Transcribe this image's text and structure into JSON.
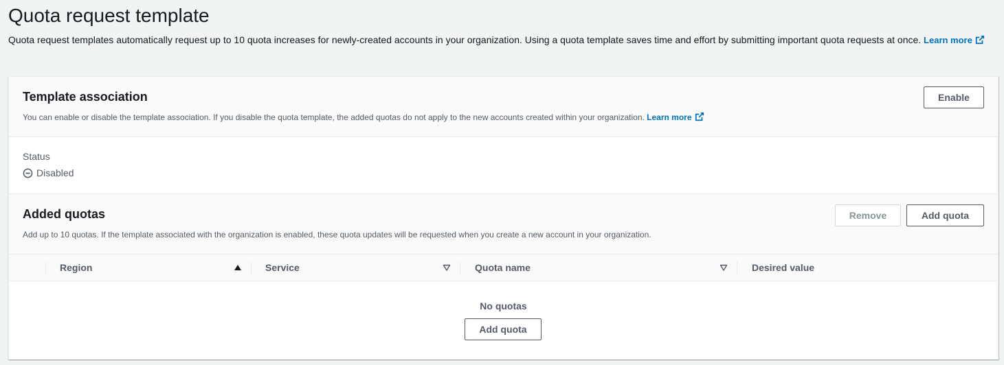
{
  "page": {
    "title": "Quota request template",
    "description": "Quota request templates automatically request up to 10 quota increases for newly-created accounts in your organization. Using a quota template saves time and effort by submitting important quota requests at once.",
    "learn_more": "Learn more"
  },
  "association": {
    "title": "Template association",
    "description": "You can enable or disable the template association. If you disable the quota template, the added quotas do not apply to the new accounts created within your organization.",
    "learn_more": "Learn more",
    "enable_label": "Enable",
    "status_label": "Status",
    "status_value": "Disabled"
  },
  "quotas": {
    "title": "Added quotas",
    "description": "Add up to 10 quotas. If the template associated with the organization is enabled, these quota updates will be requested when you create a new account in your organization.",
    "remove_label": "Remove",
    "add_label": "Add quota",
    "columns": [
      "Region",
      "Service",
      "Quota name",
      "Desired value"
    ],
    "sort": {
      "column": "Region",
      "direction": "ascending"
    },
    "empty_title": "No quotas",
    "empty_add_label": "Add quota"
  },
  "colors": {
    "link": "#0073bb",
    "text_primary": "#16191f",
    "text_secondary": "#545b64",
    "background": "#f2f3f3"
  }
}
